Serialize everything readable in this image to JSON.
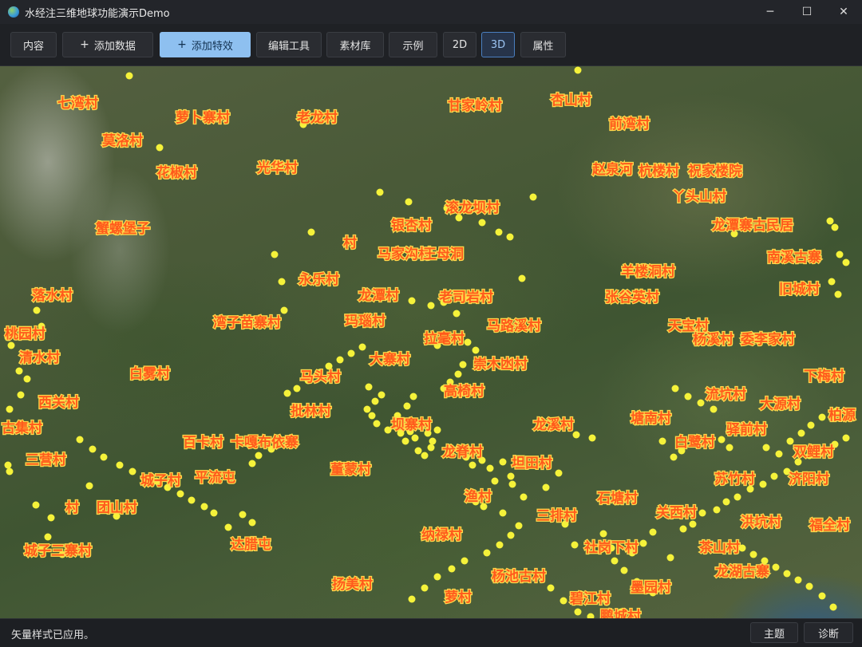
{
  "window": {
    "title": "水经注三维地球功能演示Demo",
    "minimize_glyph": "─",
    "maximize_glyph": "☐",
    "close_glyph": "✕"
  },
  "toolbar": {
    "content": "内容",
    "add_data": "添加数据",
    "add_effects": "添加特效",
    "edit_tools": "编辑工具",
    "material_library": "素材库",
    "examples": "示例",
    "view_2d": "2D",
    "view_3d": "3D",
    "properties": "属性",
    "plus_glyph": "+",
    "selected_view": "3D"
  },
  "map": {
    "basemap": "satellite imagery",
    "point_color": "#f5f23a",
    "label_fill": "#ff5a1c",
    "label_halo": "#ffd84a",
    "labels": [
      {
        "name": "七湾村"
      },
      {
        "name": "萝卜寨村"
      },
      {
        "name": "老龙村"
      },
      {
        "name": "甘家岭村"
      },
      {
        "name": "杏山村"
      },
      {
        "name": "前湾村"
      },
      {
        "name": "莫洛村"
      },
      {
        "name": "花椒村"
      },
      {
        "name": "光华村"
      },
      {
        "name": "赵泉河"
      },
      {
        "name": "杭楼村"
      },
      {
        "name": "祝家楼院"
      },
      {
        "name": "丫头山村"
      },
      {
        "name": "滚龙坝村"
      },
      {
        "name": "银杏村"
      },
      {
        "name": "蟹螺堡子"
      },
      {
        "name": "村"
      },
      {
        "name": "马家沟村"
      },
      {
        "name": "王母洞"
      },
      {
        "name": "龙潭寨古民居"
      },
      {
        "name": "南溪古寨"
      },
      {
        "name": "羊楼洞村"
      },
      {
        "name": "永乐村"
      },
      {
        "name": "旧城村"
      },
      {
        "name": "落水村"
      },
      {
        "name": "龙潭村"
      },
      {
        "name": "老司岩村"
      },
      {
        "name": "张谷英村"
      },
      {
        "name": "湾子苗寨村"
      },
      {
        "name": "玛瑙村"
      },
      {
        "name": "马路溪村"
      },
      {
        "name": "天宝村"
      },
      {
        "name": "桃园村"
      },
      {
        "name": "拉毫村"
      },
      {
        "name": "杨溪村"
      },
      {
        "name": "委李家村"
      },
      {
        "name": "清水村"
      },
      {
        "name": "大寨村"
      },
      {
        "name": "崇木凼村"
      },
      {
        "name": "白雾村"
      },
      {
        "name": "马头村"
      },
      {
        "name": "下梅村"
      },
      {
        "name": "西关村"
      },
      {
        "name": "高椅村"
      },
      {
        "name": "流坑村"
      },
      {
        "name": "大源村"
      },
      {
        "name": "批林村"
      },
      {
        "name": "坝寨村"
      },
      {
        "name": "龙溪村"
      },
      {
        "name": "塘南村"
      },
      {
        "name": "柏源"
      },
      {
        "name": "古集村"
      },
      {
        "name": "驿前村"
      },
      {
        "name": "百卡村"
      },
      {
        "name": "卡嘎布依寨"
      },
      {
        "name": "白鹭村"
      },
      {
        "name": "龙脊村"
      },
      {
        "name": "双鲤村"
      },
      {
        "name": "三营村"
      },
      {
        "name": "董蒙村"
      },
      {
        "name": "坦田村"
      },
      {
        "name": "城子村"
      },
      {
        "name": "平流屯"
      },
      {
        "name": "苏竹村"
      },
      {
        "name": "济阳村"
      },
      {
        "name": "渔村"
      },
      {
        "name": "石塘村"
      },
      {
        "name": "村"
      },
      {
        "name": "团山村"
      },
      {
        "name": "关西村"
      },
      {
        "name": "三排村"
      },
      {
        "name": "洪坑村"
      },
      {
        "name": "福全村"
      },
      {
        "name": "纳禄村"
      },
      {
        "name": "达腊屯"
      },
      {
        "name": "城子三寨村"
      },
      {
        "name": "社岗下村"
      },
      {
        "name": "茶山村"
      },
      {
        "name": "杨池古村"
      },
      {
        "name": "龙湖古寨"
      },
      {
        "name": "扬美村"
      },
      {
        "name": "墨园村"
      },
      {
        "name": "萝村"
      },
      {
        "name": "碧江村"
      },
      {
        "name": "鹏城村"
      }
    ]
  },
  "status": {
    "message": "矢量样式已应用。",
    "theme_button": "主题",
    "diagnose_button": "诊断"
  }
}
